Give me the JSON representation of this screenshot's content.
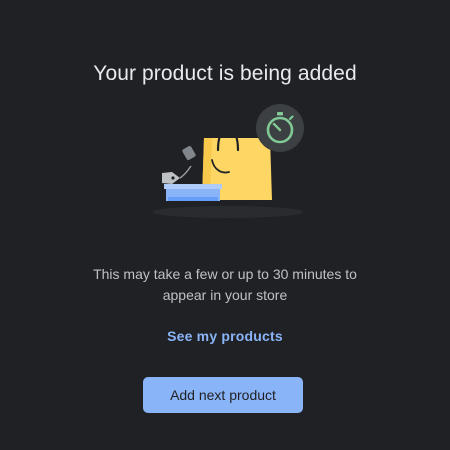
{
  "dialog": {
    "title": "Your product is being added",
    "message_line1": "This may take a few or up to 30 minutes to",
    "message_line2": "appear in your store",
    "link_label": "See my products",
    "primary_button_label": "Add next product"
  },
  "illustration": {
    "icons": [
      "shopping-bag-icon",
      "stopwatch-icon",
      "price-tag-icon",
      "box-icon"
    ]
  },
  "colors": {
    "background": "#202124",
    "text_primary": "#e8eaed",
    "text_secondary": "#bdc1c6",
    "accent": "#8ab4f8",
    "bag_yellow": "#fdd663",
    "box_blue": "#8ab4f8",
    "timer_green": "#81c995"
  }
}
